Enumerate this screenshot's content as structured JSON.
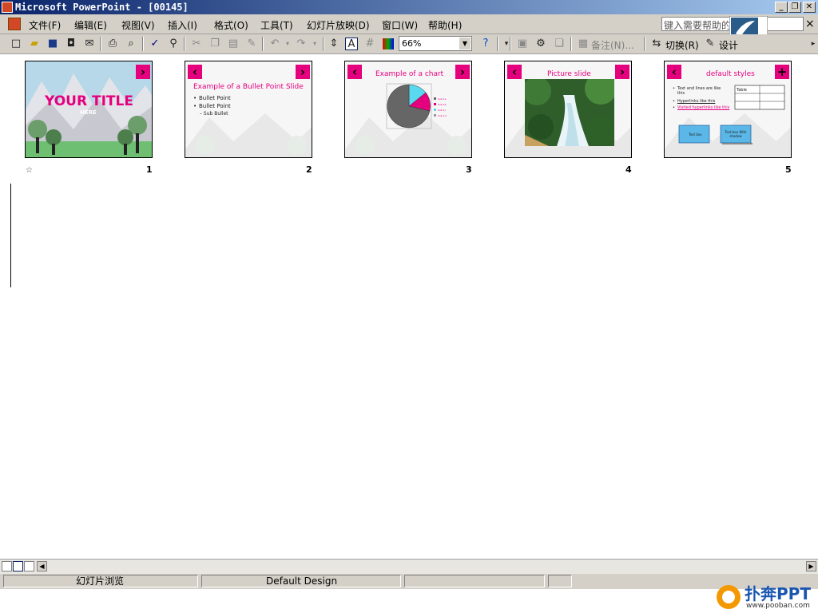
{
  "window": {
    "title": "Microsoft PowerPoint - [00145]"
  },
  "menu": {
    "items": [
      "文件(F)",
      "编辑(E)",
      "视图(V)",
      "插入(I)",
      "格式(O)",
      "工具(T)",
      "幻灯片放映(D)",
      "窗口(W)",
      "帮助(H)"
    ],
    "help_placeholder": "键入需要帮助的问题"
  },
  "toolbar": {
    "zoom": "66%",
    "notes_label": "备注(N)...",
    "switch_label": "切换(R)",
    "design_label": "设计"
  },
  "slides": [
    {
      "number": "1",
      "title": "YOUR TITLE",
      "subtitle": "HERE"
    },
    {
      "number": "2",
      "title": "Example of a Bullet Point Slide",
      "bullets": [
        "Bullet Point",
        "Bullet Point"
      ],
      "sub_bullet": "– Sub Bullet"
    },
    {
      "number": "3",
      "title": "Example of a chart",
      "legend": [
        "Sub 1a",
        "Sub 1b",
        "Sub 1c",
        "Sub 1d"
      ]
    },
    {
      "number": "4",
      "title": "Picture slide"
    },
    {
      "number": "5",
      "title": "default styles",
      "bullets": [
        "Text and lines are like this",
        "Hyperlinks like this",
        "Visited hyperlinks like this"
      ],
      "table_label": "Table",
      "box1": "Text box",
      "box2": "Text box With shadow"
    }
  ],
  "status": {
    "view_name": "幻灯片浏览",
    "design_name": "Default Design"
  },
  "watermark": {
    "brand": "扑奔PPT",
    "url": "www.pooban.com"
  },
  "colors": {
    "accent": "#e5007e",
    "titlebar_start": "#0a246a",
    "titlebar_end": "#a6caf0",
    "chrome": "#d4d0c8"
  }
}
